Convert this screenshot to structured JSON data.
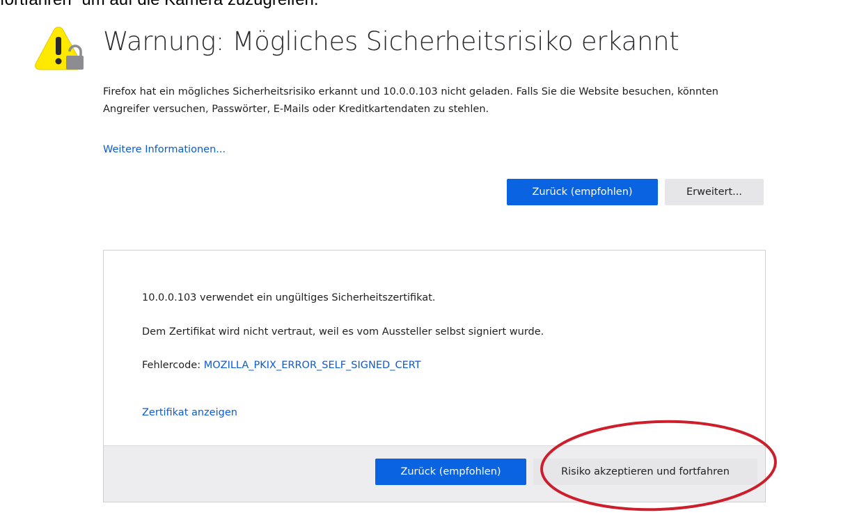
{
  "page": {
    "clipped_top_text": "fortfahren“ um auf die Kamera zuzugreifen.",
    "title": "Warnung: Mögliches Sicherheitsrisiko erkannt",
    "intro_text": "Firefox hat ein mögliches Sicherheitsrisiko erkannt und 10.0.0.103 nicht geladen. Falls Sie die Website besuchen, könnten Angreifer versuchen, Passwörter, E-Mails oder Kreditkartendaten zu stehlen.",
    "more_info_link": "Weitere Informationen...",
    "buttons": {
      "back_recommended": "Zurück (empfohlen)",
      "advanced": "Erweitert..."
    },
    "icons": {
      "warning": "warning-icon",
      "lock": "lock-icon"
    },
    "colors": {
      "accent": "#0a63e0",
      "link": "#0a5bd3",
      "warning_yellow": "#ffe900",
      "annotation_red": "#cc1f2b"
    }
  },
  "advanced_panel": {
    "line1": "10.0.0.103 verwendet ein ungültiges Sicherheitszertifikat.",
    "line2": "Dem Zertifikat wird nicht vertraut, weil es vom Aussteller selbst signiert wurde.",
    "error_code_label": "Fehlercode: ",
    "error_code": "MOZILLA_PKIX_ERROR_SELF_SIGNED_CERT",
    "view_certificate_link": "Zertifikat anzeigen",
    "buttons": {
      "back_recommended": "Zurück (empfohlen)",
      "accept_risk": "Risiko akzeptieren und fortfahren"
    }
  }
}
